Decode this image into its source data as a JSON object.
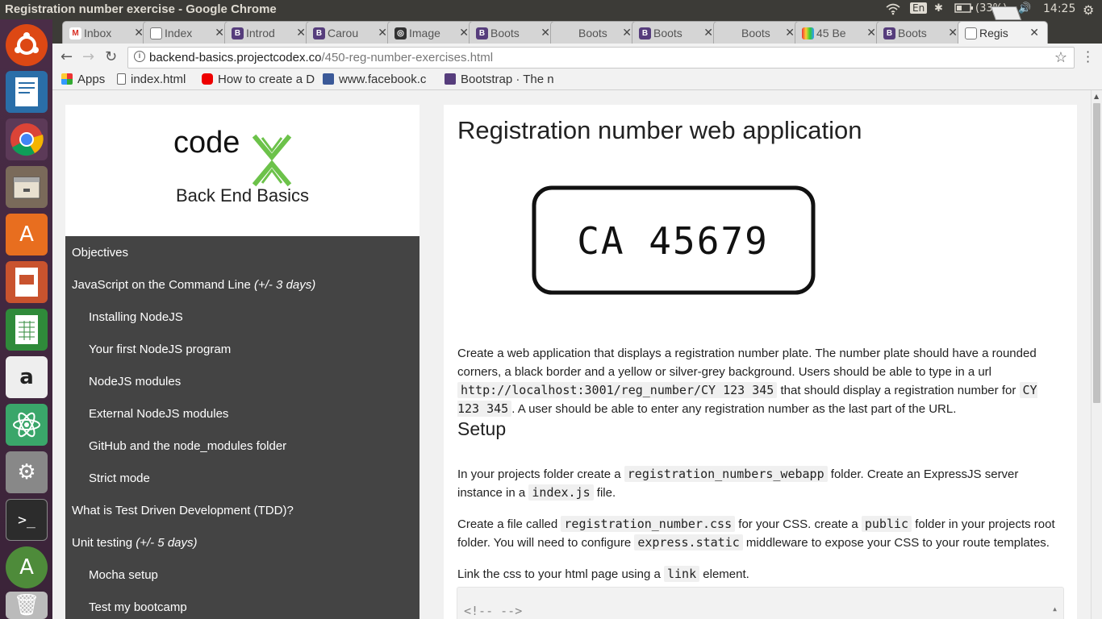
{
  "window_title": "Registration number exercise - Google Chrome",
  "indicators": {
    "lang": "En",
    "battery": "(33%)",
    "time": "14:25"
  },
  "tabs": [
    {
      "label": "Inbox",
      "icon": "gmail-icon"
    },
    {
      "label": "Index",
      "icon": "page-icon"
    },
    {
      "label": "Introd",
      "icon": "bootstrap-icon"
    },
    {
      "label": "Carou",
      "icon": "bootstrap-icon"
    },
    {
      "label": "Image",
      "icon": "image-icon"
    },
    {
      "label": "Boots",
      "icon": "bootstrap-icon"
    },
    {
      "label": "Boots",
      "icon": "none"
    },
    {
      "label": "Boots",
      "icon": "bootstrap-icon"
    },
    {
      "label": "Boots",
      "icon": "none"
    },
    {
      "label": "45 Be",
      "icon": "site-icon"
    },
    {
      "label": "Boots",
      "icon": "bootstrap-icon"
    },
    {
      "label": "Regis",
      "icon": "page-icon"
    }
  ],
  "address": {
    "host": "backend-basics.projectcodex.co",
    "path": "/450-reg-number-exercises.html"
  },
  "bookmarks": [
    {
      "label": "Apps",
      "icon": "apps-grid-icon"
    },
    {
      "label": "index.html",
      "icon": "page-icon"
    },
    {
      "label": "How to create a D",
      "icon": "youtube-icon"
    },
    {
      "label": "www.facebook.c",
      "icon": "facebook-icon"
    },
    {
      "label": "Bootstrap · The n",
      "icon": "bootstrap-icon"
    }
  ],
  "sidebar": {
    "logo_text": "code",
    "title": "Back End Basics",
    "items": [
      {
        "label": "Objectives",
        "note": ""
      },
      {
        "label": "JavaScript on the Command Line",
        "note": "(+/- 3 days)"
      },
      {
        "label": "Installing NodeJS",
        "note": ""
      },
      {
        "label": "Your first NodeJS program",
        "note": ""
      },
      {
        "label": "NodeJS modules",
        "note": ""
      },
      {
        "label": "External NodeJS modules",
        "note": ""
      },
      {
        "label": "GitHub and the node_modules folder",
        "note": ""
      },
      {
        "label": "Strict mode",
        "note": ""
      },
      {
        "label": "What is Test Driven Development (TDD)?",
        "note": ""
      },
      {
        "label": "Unit testing",
        "note": "(+/- 5 days)"
      },
      {
        "label": "Mocha setup",
        "note": ""
      },
      {
        "label": "Test my bootcamp",
        "note": ""
      }
    ]
  },
  "content": {
    "title": "Registration number web application",
    "plate_text": "CA 45679",
    "p1": {
      "a": "Create a web application that displays a registration number plate. The number plate should have a rounded corners, a black border and a yellow or silver-grey background. Users should be able to type in a url ",
      "code1": "http://localhost:3001/reg_number/CY 123 345",
      "b": " that should display a registration number for ",
      "code2": "CY 123 345",
      "c": ". A user should be able to enter any registration number as the last part of the URL."
    },
    "setup_heading": "Setup",
    "p2": {
      "a": "In your projects folder create a ",
      "code1": "registration_numbers_webapp",
      "b": " folder. Create an ExpressJS server instance in a ",
      "code2": "index.js",
      "c": " file."
    },
    "p3": {
      "a": "Create a file called ",
      "code1": "registration_number.css",
      "b": " for your CSS. create a ",
      "code2": "public",
      "c": " folder in your projects root folder. You will need to configure ",
      "code3": "express.static",
      "d": " middleware to expose your CSS to your route templates."
    },
    "p4": {
      "a": "Link the css to your html page using a ",
      "code1": "link",
      "b": " element."
    },
    "code_block": "<!-- -->"
  }
}
